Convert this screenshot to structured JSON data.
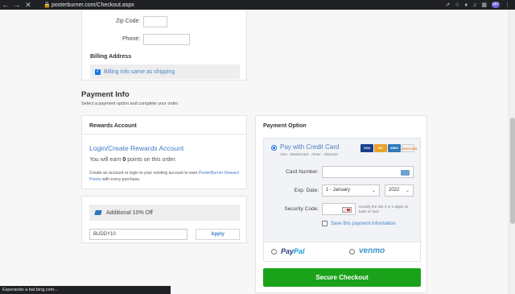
{
  "browser": {
    "url": "posterburner.com/Checkout.aspx",
    "avatar_text": "MP"
  },
  "shipping": {
    "zip_label": "Zip Code:",
    "zip_value": "",
    "phone_label": "Phone:",
    "phone_value": ""
  },
  "billing": {
    "title": "Billing Address",
    "same_as_shipping_label": "Billing info same as shipping",
    "same_as_shipping_checked": true
  },
  "payment": {
    "title": "Payment Info",
    "subtitle": "Select a payment option and complete your order."
  },
  "rewards": {
    "title": "Rewards Account",
    "login_link": "Login/Create Rewards Account",
    "earn_prefix": "You will earn ",
    "earn_points": "0",
    "earn_suffix": " points on this order.",
    "info_prefix": "Create an account or login to your existing account to earn ",
    "info_link": "PosterBurner Reward Points",
    "info_suffix": " with every purchase."
  },
  "coupon": {
    "label": "Additional 10% Off",
    "code_value": "BUDDY10",
    "apply_label": "Apply"
  },
  "payment_option": {
    "title": "Payment Option",
    "credit_card_label": "Pay with Credit Card",
    "credit_card_sub": "Visa - Mastercard - Amex - Discover",
    "card_logos": [
      "VISA",
      "MC",
      "AMEX",
      "DISCOVER"
    ],
    "card_number_label": "Card Number:",
    "card_number_value": "",
    "exp_label": "Exp. Date:",
    "exp_month": "1 - January",
    "exp_year": "2022",
    "security_label": "Security Code:",
    "security_value": "",
    "security_note": "Usually the last 3 or 4 digits on back of card",
    "save_label": "Save this payment information",
    "paypal_pay": "Pay",
    "paypal_pal": "Pal",
    "venmo_label": "venmo",
    "checkout_label": "Secure Checkout"
  },
  "status_bar": {
    "text": "Esperando a bat.bing.com..."
  }
}
